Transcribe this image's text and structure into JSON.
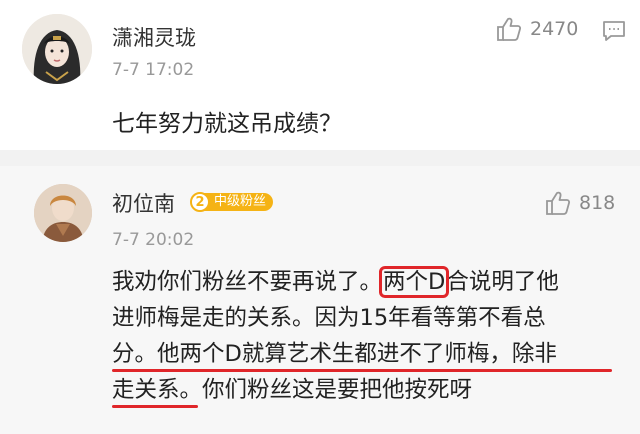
{
  "comments": [
    {
      "username": "潇湘灵珑",
      "timestamp": "7-7 17:02",
      "like_count": "2470",
      "text": "七年努力就这吊成绩？"
    },
    {
      "username": "初位南",
      "badge_level": "2",
      "badge_label": "中级粉丝",
      "timestamp": "7-7 20:02",
      "like_count": "818",
      "lines": [
        {
          "a": "我劝你们粉丝不要再说了。",
          "boxed": "两个D",
          "b": "合说明了他"
        },
        {
          "text": "进师梅是走的关系。因为15年看等第不看总"
        },
        {
          "a": "分。",
          "underlined": "他两个D就算艺术生都进不了师梅，除非"
        },
        {
          "underlined": "走关系",
          "b": "。你们粉丝这是要把他按死呀"
        }
      ]
    }
  ],
  "colors": {
    "accent_red": "#e0262a",
    "badge_gold": "#f5b315",
    "muted_text": "#999999"
  }
}
